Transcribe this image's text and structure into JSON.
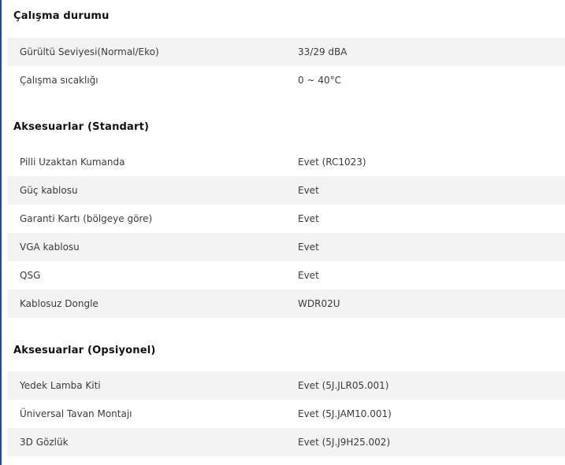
{
  "sections": [
    {
      "title": "Çalışma durumu",
      "rows": [
        {
          "label": "Gürültü Seviyesi(Normal/Eko)",
          "value": "33/29 dBA"
        },
        {
          "label": "Çalışma sıcaklığı",
          "value": "0 ~ 40°C"
        }
      ]
    },
    {
      "title": "Aksesuarlar (Standart)",
      "rows": [
        {
          "label": "Pilli Uzaktan Kumanda",
          "value": "Evet (RC1023)"
        },
        {
          "label": "Güç kablosu",
          "value": "Evet"
        },
        {
          "label": "Garanti Kartı (bölgeye göre)",
          "value": "Evet"
        },
        {
          "label": "VGA kablosu",
          "value": "Evet"
        },
        {
          "label": "QSG",
          "value": "Evet"
        },
        {
          "label": "Kablosuz Dongle",
          "value": "WDR02U"
        }
      ]
    },
    {
      "title": "Aksesuarlar (Opsiyonel)",
      "rows": [
        {
          "label": "Yedek Lamba Kiti",
          "value": "Evet (5J.JLR05.001)"
        },
        {
          "label": "Üniversal Tavan Montajı",
          "value": "Evet (5J.JAM10.001)"
        },
        {
          "label": "3D Gözlük",
          "value": "Evet (5J.J9H25.002)"
        }
      ]
    }
  ]
}
